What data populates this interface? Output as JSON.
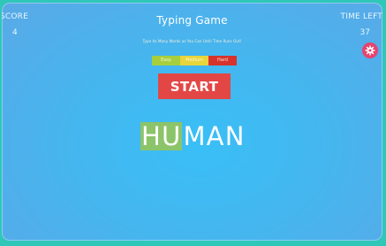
{
  "header": {
    "title": "Typing Game",
    "subtitle": "Type As Many Words as You Can Until Time Runs Out!",
    "score_label": "SCORE",
    "score_value": "4",
    "time_label": "TIME LEFT",
    "time_value": "37"
  },
  "difficulty": {
    "easy": "Easy",
    "medium": "Medium",
    "hard": "Hard"
  },
  "start_button": {
    "label": "START"
  },
  "word": {
    "typed": "HU",
    "remaining": "MAN"
  },
  "colors": {
    "background_frame": "#45b6ef",
    "outer_border": "#2ec7b8",
    "easy": "#a7cf3d",
    "medium": "#e7d53c",
    "hard": "#d7332d",
    "start": "#e34745",
    "typed_highlight": "#8cc46a",
    "settings": "#e7436f"
  },
  "icons": {
    "settings": "gear-icon"
  }
}
